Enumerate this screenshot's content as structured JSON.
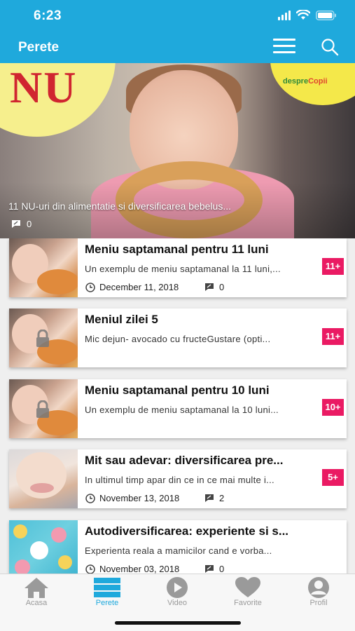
{
  "status_bar": {
    "time": "6:23"
  },
  "header": {
    "title": "Perete"
  },
  "hero": {
    "overlay_text": "NU",
    "logo_text_a": "despre",
    "logo_text_b": "Copii",
    "title": "11 NU-uri din alimentatie si diversificarea bebelus...",
    "comments": "0"
  },
  "articles": [
    {
      "title": "Meniu saptamanal pentru 11 luni",
      "excerpt": "Un exemplu de meniu saptamanal la 11 luni,...",
      "badge": "11+",
      "date": "December 11, 2018",
      "comments": "0"
    },
    {
      "title": "Meniul zilei 5",
      "excerpt": "Mic dejun- avocado cu fructeGustare (opti...",
      "badge": "11+"
    },
    {
      "title": "Meniu saptamanal pentru 10 luni",
      "excerpt": "Un exemplu de meniu saptamanal la 10 luni...",
      "badge": "10+"
    },
    {
      "title": "Mit sau adevar: diversificarea pre...",
      "excerpt": "In ultimul timp apar din ce in ce mai multe i...",
      "badge": "5+",
      "date": "November 13, 2018",
      "comments": "2"
    },
    {
      "title": "Autodiversificarea: experiente si s...",
      "excerpt": "Experienta reala a mamicilor cand e vorba...",
      "date": "November 03, 2018",
      "comments": "0"
    }
  ],
  "tabs": [
    {
      "label": "Acasa",
      "icon": "home-icon"
    },
    {
      "label": "Perete",
      "icon": "wall-list-icon",
      "active": true
    },
    {
      "label": "Video",
      "icon": "play-icon"
    },
    {
      "label": "Favorite",
      "icon": "heart-icon"
    },
    {
      "label": "Profil",
      "icon": "profile-icon"
    }
  ],
  "colors": {
    "primary": "#1fa9dc",
    "badge": "#ea1a63",
    "tab_inactive": "#9a9a9a"
  }
}
